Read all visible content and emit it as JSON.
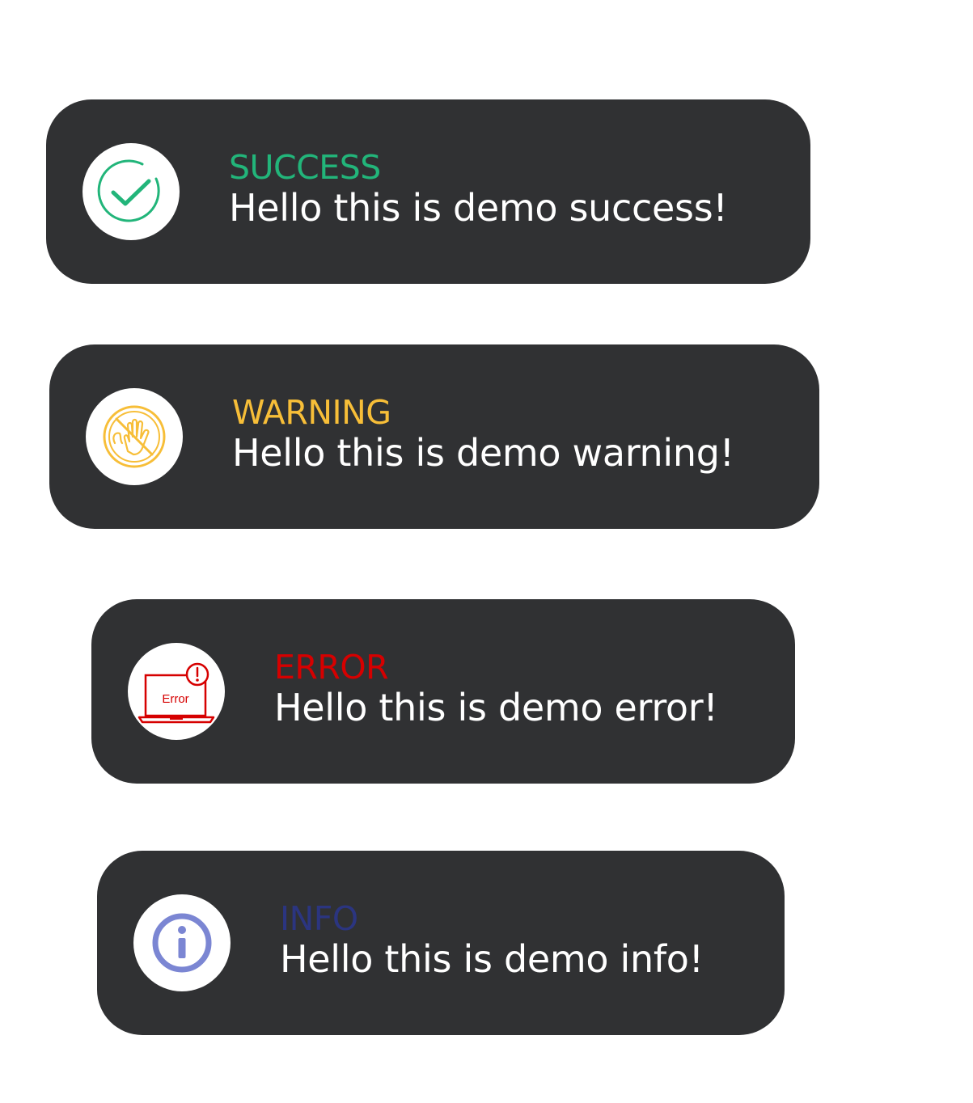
{
  "toasts": [
    {
      "type": "success",
      "title": "SUCCESS",
      "message": "Hello this is demo success!",
      "icon": "check-circle-icon",
      "color": "#22b57a"
    },
    {
      "type": "warning",
      "title": "WARNING",
      "message": "Hello this is demo warning!",
      "icon": "no-hand-icon",
      "color": "#f7be38"
    },
    {
      "type": "error",
      "title": "ERROR",
      "message": "Hello this is demo error!",
      "icon": "laptop-error-icon",
      "icon_label": "Error",
      "color": "#d60000"
    },
    {
      "type": "info",
      "title": "INFO",
      "message": "Hello this is demo info!",
      "icon": "info-icon",
      "color": "#2b3580",
      "icon_color": "#7b86d3"
    }
  ]
}
